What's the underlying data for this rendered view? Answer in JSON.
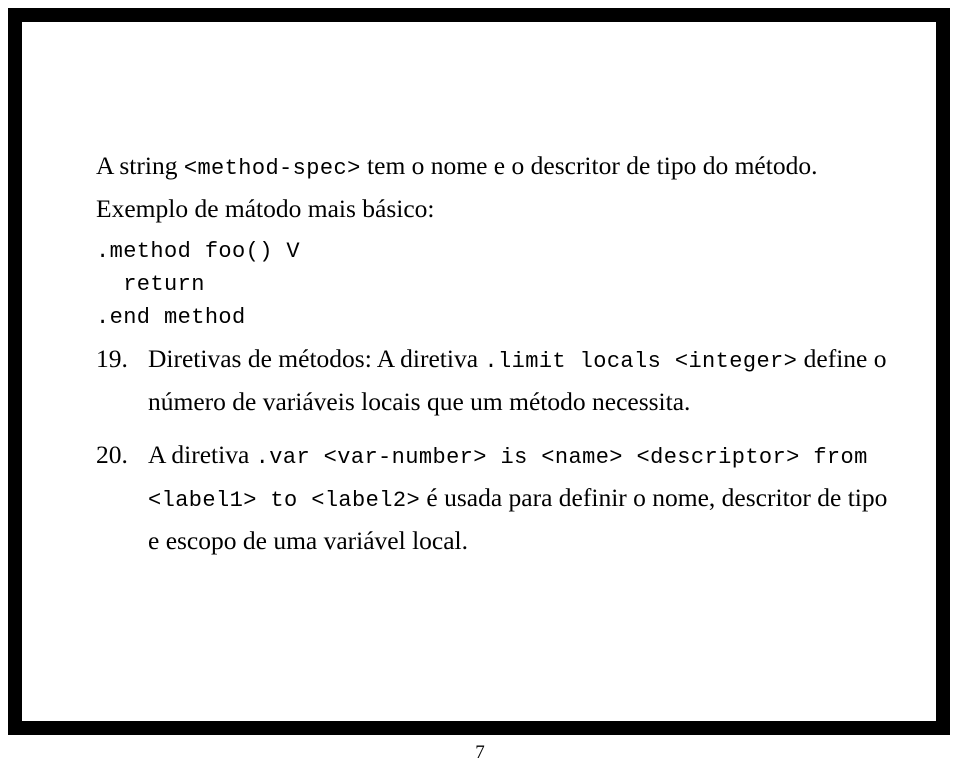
{
  "slide": {
    "page_number": "7",
    "border_color": "#000000",
    "background_color": "#ffffff",
    "text_color": "#000000",
    "intro_paragraph": {
      "segment_1": "A string ",
      "code_1": "<method-spec>",
      "segment_2": " tem o nome e o descritor de tipo do método. Exemplo de mátodo mais básico:"
    },
    "code_block": {
      "lines": [
        ".method foo() V",
        "  return",
        ".end method"
      ]
    },
    "items": [
      {
        "number": "19.",
        "segment_1": "Diretivas de métodos: A diretiva ",
        "code_1": ".limit locals <integer>",
        "segment_2": " define o número de variáveis locais que um método necessita."
      },
      {
        "number": "20.",
        "segment_1": "A diretiva ",
        "code_1": ".var <var-number> is <name> <descriptor> from <label1> to <label2>",
        "segment_2": " é usada para definir o nome, descritor de tipo e escopo de uma variável local."
      }
    ]
  }
}
